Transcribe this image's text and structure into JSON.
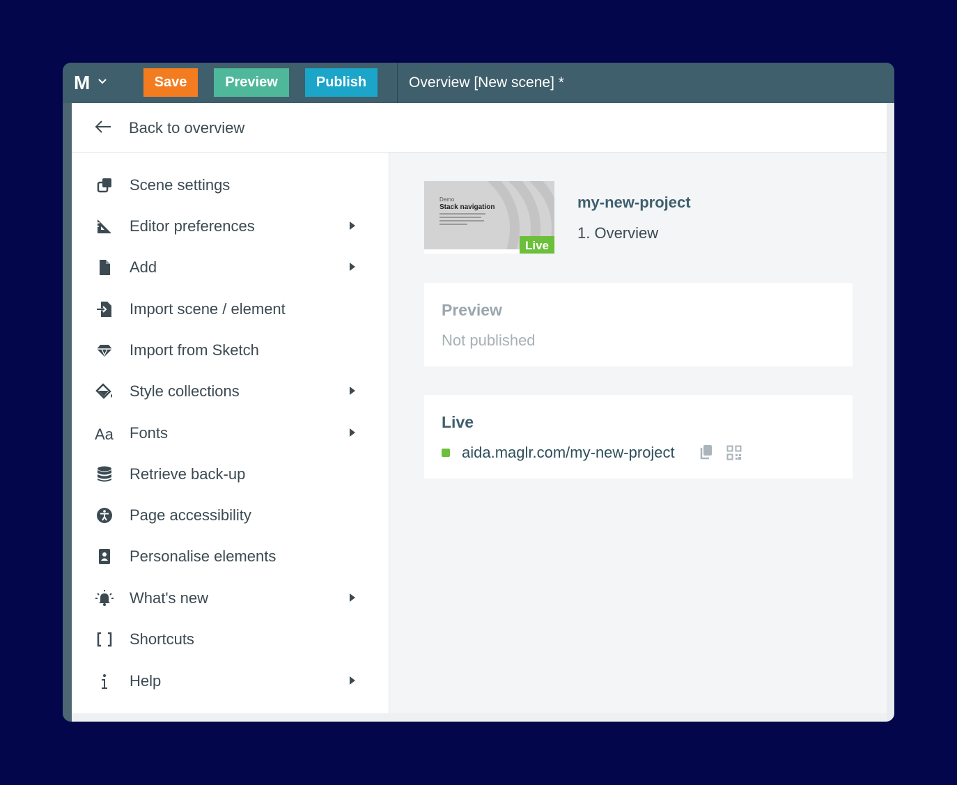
{
  "topbar": {
    "logo": "M",
    "save_label": "Save",
    "preview_label": "Preview",
    "publish_label": "Publish",
    "scene_title": "Overview [New scene] *",
    "colors": {
      "save": "#f47c20",
      "preview": "#4fb89a",
      "publish": "#1aa5c9",
      "bar": "#3f5f6c"
    }
  },
  "panel": {
    "back_label": "Back to overview",
    "menu": [
      {
        "label": "Scene settings",
        "icon": "scene-settings-icon",
        "submenu": false
      },
      {
        "label": "Editor preferences",
        "icon": "ruler-icon",
        "submenu": true
      },
      {
        "label": "Add",
        "icon": "file-icon",
        "submenu": true
      },
      {
        "label": "Import scene / element",
        "icon": "import-file-icon",
        "submenu": false
      },
      {
        "label": "Import from Sketch",
        "icon": "diamond-icon",
        "submenu": false
      },
      {
        "label": "Style collections",
        "icon": "paint-bucket-icon",
        "submenu": true
      },
      {
        "label": "Fonts",
        "icon": "font-icon",
        "submenu": true
      },
      {
        "label": "Retrieve back-up",
        "icon": "database-icon",
        "submenu": false
      },
      {
        "label": "Page accessibility",
        "icon": "accessibility-icon",
        "submenu": false
      },
      {
        "label": "Personalise elements",
        "icon": "contact-card-icon",
        "submenu": false
      },
      {
        "label": "What's new",
        "icon": "bell-icon",
        "submenu": true
      },
      {
        "label": "Shortcuts",
        "icon": "brackets-icon",
        "submenu": false
      },
      {
        "label": "Help",
        "icon": "info-icon",
        "submenu": true
      }
    ]
  },
  "project": {
    "thumb_small": "Demo",
    "thumb_title": "Stack navigation",
    "live_badge": "Live",
    "name": "my-new-project",
    "scene": "1.  Overview"
  },
  "preview_card": {
    "title": "Preview",
    "status": "Not published"
  },
  "live_card": {
    "title": "Live",
    "url": "aida.maglr.com/my-new-project",
    "status_color": "#6cbf3a"
  }
}
